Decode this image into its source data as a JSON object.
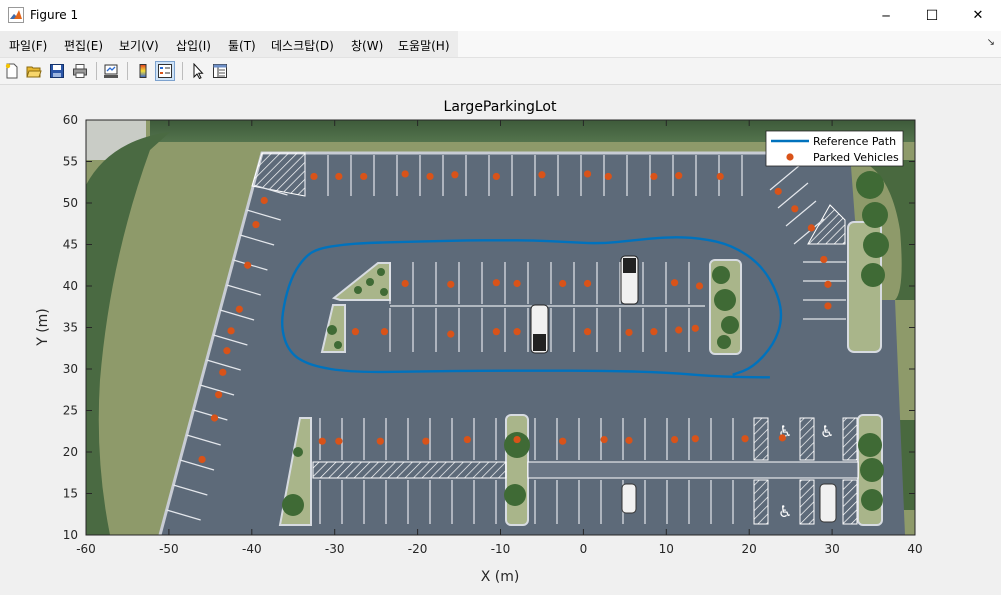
{
  "window": {
    "title": "Figure 1",
    "controls": [
      "─",
      "☐",
      "✕"
    ]
  },
  "menu": {
    "items": [
      "파일(F)",
      "편집(E)",
      "보기(V)",
      "삽입(I)",
      "툴(T)",
      "데스크탑(D)",
      "창(W)",
      "도움말(H)"
    ]
  },
  "toolbar": {
    "icons": [
      "new-figure-icon",
      "open-file-icon",
      "save-icon",
      "print-icon",
      "link-plot-icon",
      "insert-colorbar-icon",
      "insert-legend-icon",
      "edit-plot-icon",
      "property-inspector-icon"
    ]
  },
  "chart_data": {
    "type": "scatter",
    "title": "LargeParkingLot",
    "xlabel": "X (m)",
    "ylabel": "Y (m)",
    "xlim": [
      -60,
      40
    ],
    "ylim": [
      10,
      60
    ],
    "xticks": [
      -60,
      -50,
      -40,
      -30,
      -20,
      -10,
      0,
      10,
      20,
      30,
      40
    ],
    "yticks": [
      10,
      15,
      20,
      25,
      30,
      35,
      40,
      45,
      50,
      55,
      60
    ],
    "legend": {
      "placement": "top-right",
      "entries": [
        "Reference Path",
        "Parked Vehicles"
      ]
    },
    "series": [
      {
        "name": "Reference Path",
        "kind": "line",
        "color": "#0072bd",
        "x": [
          22.5,
          17.0,
          10.0,
          2.0,
          -5.0,
          -12.0,
          -20.0,
          -28.0,
          -33.0,
          -35.5,
          -36.5,
          -36.0,
          -35.0,
          -33.5,
          -32.0,
          -29.0,
          -26.0,
          -22.0,
          -18.0,
          -14.0,
          -10.0,
          -6.0,
          -2.0,
          2.0,
          6.0,
          10.0,
          14.0,
          18.0,
          21.5,
          23.5,
          24.0,
          23.0,
          20.5,
          18.0
        ],
        "y": [
          29.0,
          29.0,
          29.6,
          29.8,
          29.8,
          29.8,
          29.7,
          29.6,
          30.4,
          32.0,
          35.0,
          38.5,
          41.5,
          43.6,
          44.5,
          45.0,
          45.2,
          45.3,
          45.4,
          45.5,
          45.5,
          45.5,
          45.3,
          45.1,
          45.5,
          45.9,
          45.8,
          44.9,
          42.5,
          39.0,
          36.0,
          33.0,
          30.2,
          29.3
        ]
      },
      {
        "name": "Parked Vehicles",
        "kind": "scatter",
        "color": "#d95319",
        "points": [
          [
            -32.5,
            53.2
          ],
          [
            -29.5,
            53.2
          ],
          [
            -26.5,
            53.2
          ],
          [
            -21.5,
            53.5
          ],
          [
            -18.5,
            53.2
          ],
          [
            -15.5,
            53.4
          ],
          [
            -10.5,
            53.2
          ],
          [
            -5.0,
            53.4
          ],
          [
            0.5,
            53.5
          ],
          [
            3.0,
            53.2
          ],
          [
            8.5,
            53.2
          ],
          [
            11.5,
            53.3
          ],
          [
            16.5,
            53.2
          ],
          [
            23.5,
            51.4
          ],
          [
            25.5,
            49.3
          ],
          [
            27.5,
            47.0
          ],
          [
            29.0,
            43.2
          ],
          [
            29.5,
            40.2
          ],
          [
            29.5,
            37.6
          ],
          [
            -38.5,
            50.3
          ],
          [
            -39.5,
            47.4
          ],
          [
            -40.5,
            42.5
          ],
          [
            -41.5,
            37.2
          ],
          [
            -42.5,
            34.6
          ],
          [
            -43.0,
            32.2
          ],
          [
            -43.5,
            29.6
          ],
          [
            -44.0,
            26.9
          ],
          [
            -44.5,
            24.1
          ],
          [
            -46.0,
            19.1
          ],
          [
            -21.5,
            40.3
          ],
          [
            -16.0,
            40.2
          ],
          [
            -10.5,
            40.4
          ],
          [
            -8.0,
            40.3
          ],
          [
            -2.5,
            40.3
          ],
          [
            0.5,
            40.3
          ],
          [
            11.0,
            40.4
          ],
          [
            14.0,
            40.0
          ],
          [
            -27.5,
            34.5
          ],
          [
            -24.0,
            34.5
          ],
          [
            -16.0,
            34.2
          ],
          [
            -10.5,
            34.5
          ],
          [
            -8.0,
            34.5
          ],
          [
            0.5,
            34.5
          ],
          [
            5.5,
            34.4
          ],
          [
            8.5,
            34.5
          ],
          [
            11.5,
            34.7
          ],
          [
            13.5,
            34.9
          ],
          [
            -31.5,
            21.3
          ],
          [
            -29.5,
            21.3
          ],
          [
            -24.5,
            21.3
          ],
          [
            -19.0,
            21.3
          ],
          [
            -14.0,
            21.5
          ],
          [
            -8.0,
            21.5
          ],
          [
            -2.5,
            21.3
          ],
          [
            2.5,
            21.5
          ],
          [
            5.5,
            21.4
          ],
          [
            11.0,
            21.5
          ],
          [
            13.5,
            21.6
          ],
          [
            19.5,
            21.6
          ],
          [
            24.0,
            21.7
          ]
        ]
      }
    ]
  }
}
